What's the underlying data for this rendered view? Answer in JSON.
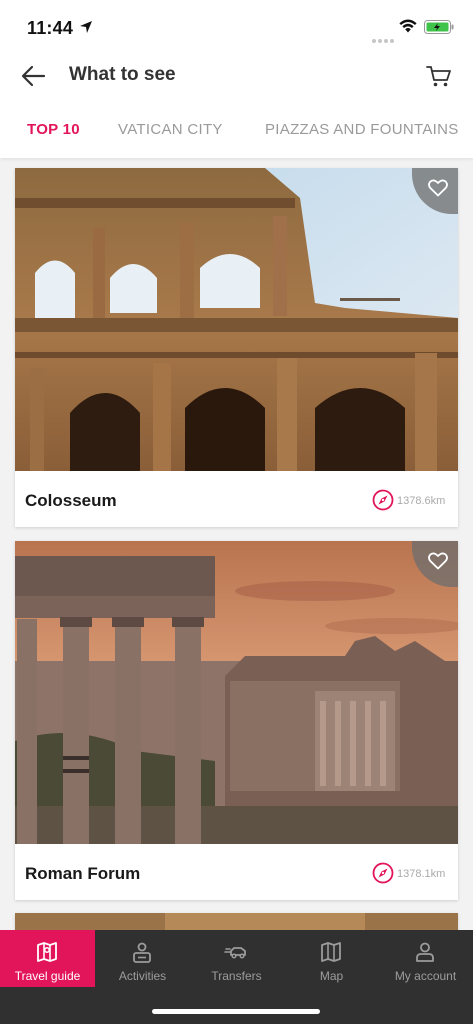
{
  "status_bar": {
    "time": "11:44"
  },
  "header": {
    "title": "What to see"
  },
  "tabs": [
    {
      "label": "TOP 10",
      "active": true
    },
    {
      "label": "VATICAN CITY",
      "active": false
    },
    {
      "label": "PIAZZAS AND FOUNTAINS",
      "active": false
    }
  ],
  "cards": [
    {
      "title": "Colosseum",
      "distance": "1378.6km"
    },
    {
      "title": "Roman Forum",
      "distance": "1378.1km"
    }
  ],
  "bottom_nav": [
    {
      "label": "Travel guide",
      "icon": "map-book-icon",
      "active": true
    },
    {
      "label": "Activities",
      "icon": "ticket-person-icon",
      "active": false
    },
    {
      "label": "Transfers",
      "icon": "car-icon",
      "active": false
    },
    {
      "label": "Map",
      "icon": "map-icon",
      "active": false
    },
    {
      "label": "My account",
      "icon": "user-icon",
      "active": false
    }
  ],
  "colors": {
    "accent": "#e2145a",
    "nav_bg": "#303030"
  }
}
